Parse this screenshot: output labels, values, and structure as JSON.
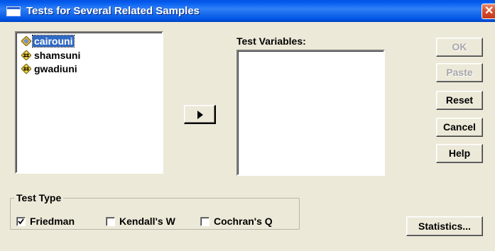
{
  "window": {
    "title": "Tests for Several Related Samples",
    "close_glyph": "✕"
  },
  "source_list": {
    "items": [
      {
        "label": "cairouni",
        "selected": true,
        "icon": "scale-variable-icon"
      },
      {
        "label": "shamsuni",
        "selected": false,
        "icon": "scale-variable-icon"
      },
      {
        "label": "gwadiuni",
        "selected": false,
        "icon": "scale-variable-icon"
      }
    ]
  },
  "target_list": {
    "label": "Test Variables:"
  },
  "move_button": {
    "icon": "right-arrow-icon"
  },
  "buttons": {
    "ok": "OK",
    "paste": "Paste",
    "reset": "Reset",
    "cancel": "Cancel",
    "help": "Help",
    "statistics": "Statistics..."
  },
  "test_type": {
    "legend": "Test Type",
    "options": [
      {
        "label": "Friedman",
        "checked": true
      },
      {
        "label": "Kendall's W",
        "checked": false
      },
      {
        "label": "Cochran's Q",
        "checked": false
      }
    ]
  },
  "colors": {
    "title_bar": "#0054e3",
    "dialog_bg": "#ece9d8",
    "selection": "#316ac5",
    "disabled_text": "#a7a6aa"
  }
}
